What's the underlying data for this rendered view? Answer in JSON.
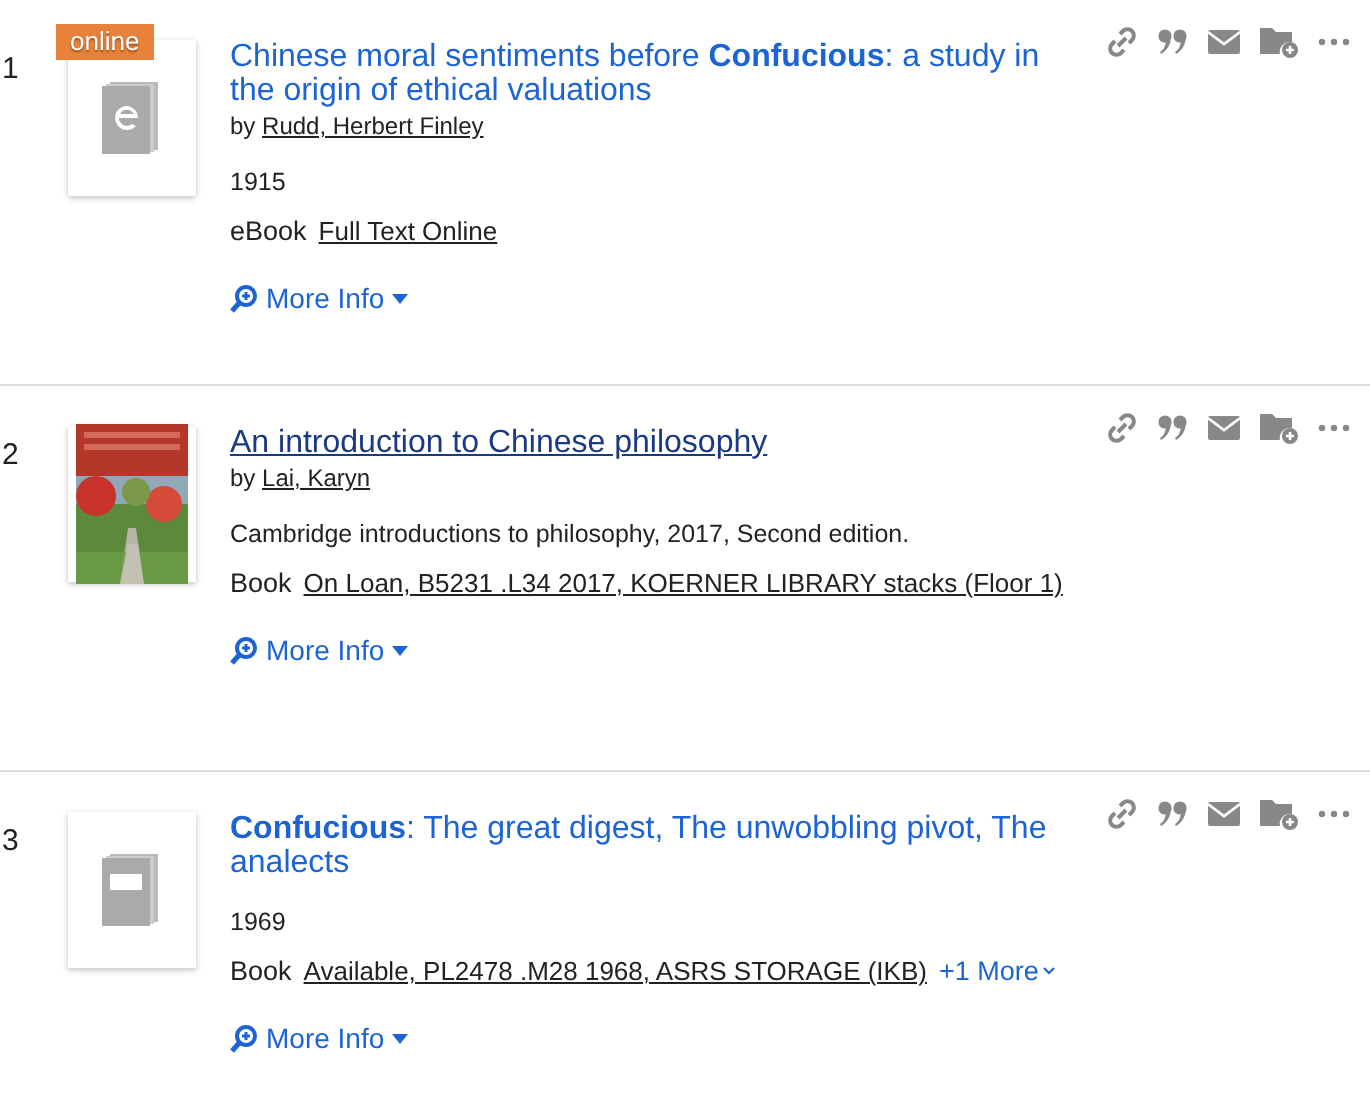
{
  "results": [
    {
      "number": "1",
      "badge": "online",
      "thumbnail": {
        "kind": "ebook"
      },
      "title": "Chinese moral sentiments before **Confucious**: a study in the origin of ethical valuations",
      "hovered": false,
      "author": {
        "prefix": "by",
        "name": "Rudd, Herbert Finley"
      },
      "details": [
        "1915"
      ],
      "format": {
        "type": "eBook",
        "availability": "Full Text Online"
      },
      "more_info": "More Info"
    },
    {
      "number": "2",
      "thumbnail": {
        "kind": "cover"
      },
      "title": "An introduction to Chinese philosophy",
      "hovered": true,
      "author": {
        "prefix": "by",
        "name": "Lai, Karyn"
      },
      "details": [
        "Cambridge introductions to philosophy, 2017, Second edition."
      ],
      "format": {
        "type": "Book",
        "availability": "On Loan, B5231 .L34 2017, KOERNER LIBRARY stacks (Floor 1)"
      },
      "more_info": "More Info"
    },
    {
      "number": "3",
      "thumbnail": {
        "kind": "book"
      },
      "title": "**Confucious**: The great digest, The unwobbling pivot, The analects",
      "hovered": false,
      "details": [
        "1969"
      ],
      "format": {
        "type": "Book",
        "availability": "Available, PL2478 .M28 1968, ASRS STORAGE (IKB)",
        "more": "+1 More"
      },
      "more_info": "More Info"
    }
  ]
}
